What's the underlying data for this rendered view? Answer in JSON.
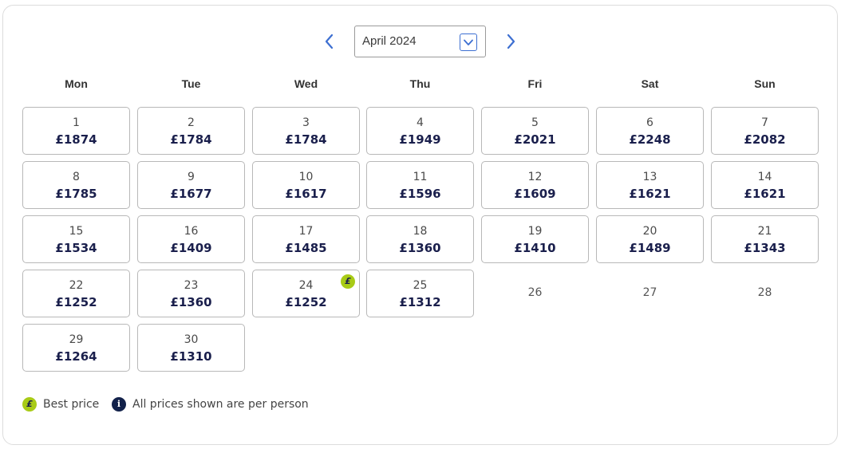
{
  "calendar": {
    "month_label": "April 2024",
    "prev_icon": "chevron-left-icon",
    "next_icon": "chevron-right-icon",
    "dropdown_icon": "chevron-down-icon",
    "weekdays": [
      "Mon",
      "Tue",
      "Wed",
      "Thu",
      "Fri",
      "Sat",
      "Sun"
    ],
    "days": [
      {
        "day": "1",
        "price": "£1874"
      },
      {
        "day": "2",
        "price": "£1784"
      },
      {
        "day": "3",
        "price": "£1784"
      },
      {
        "day": "4",
        "price": "£1949"
      },
      {
        "day": "5",
        "price": "£2021"
      },
      {
        "day": "6",
        "price": "£2248"
      },
      {
        "day": "7",
        "price": "£2082"
      },
      {
        "day": "8",
        "price": "£1785"
      },
      {
        "day": "9",
        "price": "£1677"
      },
      {
        "day": "10",
        "price": "£1617"
      },
      {
        "day": "11",
        "price": "£1596"
      },
      {
        "day": "12",
        "price": "£1609"
      },
      {
        "day": "13",
        "price": "£1621"
      },
      {
        "day": "14",
        "price": "£1621"
      },
      {
        "day": "15",
        "price": "£1534"
      },
      {
        "day": "16",
        "price": "£1409"
      },
      {
        "day": "17",
        "price": "£1485"
      },
      {
        "day": "18",
        "price": "£1360"
      },
      {
        "day": "19",
        "price": "£1410"
      },
      {
        "day": "20",
        "price": "£1489"
      },
      {
        "day": "21",
        "price": "£1343"
      },
      {
        "day": "22",
        "price": "£1252"
      },
      {
        "day": "23",
        "price": "£1360"
      },
      {
        "day": "24",
        "price": "£1252",
        "best": true
      },
      {
        "day": "25",
        "price": "£1312"
      },
      {
        "day": "26",
        "price": null
      },
      {
        "day": "27",
        "price": null
      },
      {
        "day": "28",
        "price": null
      },
      {
        "day": "29",
        "price": "£1264"
      },
      {
        "day": "30",
        "price": "£1310"
      }
    ],
    "best_badge_symbol": "£"
  },
  "legend": {
    "best_symbol": "£",
    "best_label": "Best price",
    "info_symbol": "i",
    "info_label": "All prices shown are per person"
  },
  "colors": {
    "accent": "#3d6fd1",
    "best_price": "#a8cb16",
    "price_text": "#1a1f4c",
    "info_dot": "#12214a"
  }
}
